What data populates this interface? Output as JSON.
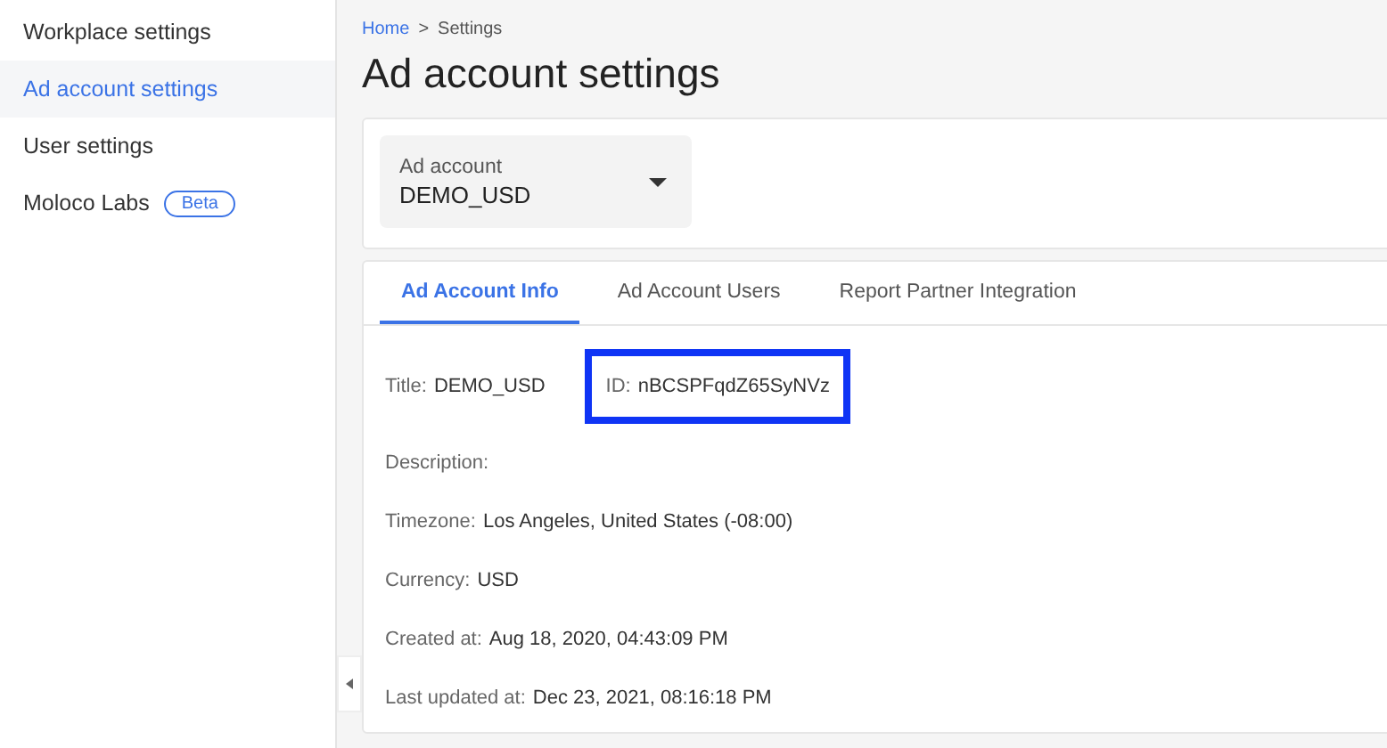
{
  "sidebar": {
    "items": [
      {
        "label": "Workplace settings",
        "selected": false
      },
      {
        "label": "Ad account settings",
        "selected": true
      },
      {
        "label": "User settings",
        "selected": false
      },
      {
        "label": "Moloco Labs",
        "selected": false,
        "badge": "Beta"
      }
    ]
  },
  "breadcrumb": {
    "link": "Home",
    "separator": ">",
    "current": "Settings"
  },
  "page_title": "Ad account settings",
  "account_select": {
    "label": "Ad account",
    "value": "DEMO_USD"
  },
  "tabs": [
    {
      "label": "Ad Account Info",
      "selected": true
    },
    {
      "label": "Ad Account Users",
      "selected": false
    },
    {
      "label": "Report Partner Integration",
      "selected": false
    }
  ],
  "info_rows": [
    [
      {
        "label": "Title:",
        "value": "DEMO_USD",
        "highlighted": false
      },
      {
        "label": "ID:",
        "value": "nBCSPFqdZ65SyNVz",
        "highlighted": true
      }
    ],
    [
      {
        "label": "Description:",
        "highlighted": false
      }
    ],
    [
      {
        "label": "Timezone:",
        "value": "Los Angeles, United States (-08:00)",
        "highlighted": false
      }
    ],
    [
      {
        "label": "Currency:",
        "value": "USD",
        "highlighted": false
      }
    ],
    [
      {
        "label": "Created at:",
        "value": "Aug 18, 2020, 04:43:09 PM",
        "highlighted": false
      }
    ],
    [
      {
        "label": "Last updated at:",
        "value": "Dec 23, 2021, 08:16:18 PM",
        "highlighted": false
      }
    ]
  ]
}
